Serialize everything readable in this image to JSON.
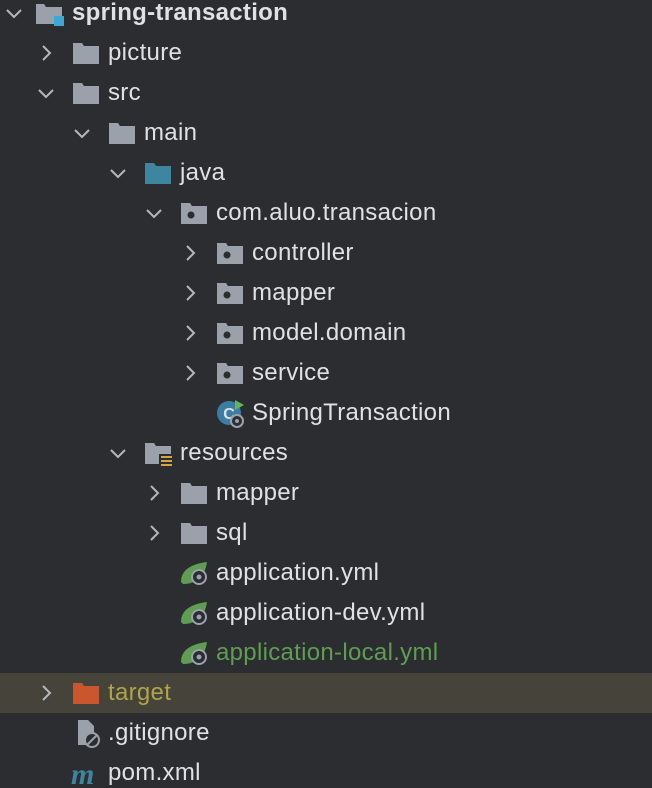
{
  "tree": {
    "root": {
      "label": "spring-transaction",
      "icon": "module-folder-icon"
    },
    "picture": {
      "label": "picture",
      "icon": "folder-icon"
    },
    "src": {
      "label": "src",
      "icon": "folder-icon"
    },
    "main": {
      "label": "main",
      "icon": "folder-icon"
    },
    "java": {
      "label": "java",
      "icon": "source-root-folder-icon"
    },
    "package": {
      "label": "com.aluo.transacion",
      "icon": "package-icon"
    },
    "controller": {
      "label": "controller",
      "icon": "package-icon"
    },
    "mapper_pkg": {
      "label": "mapper",
      "icon": "package-icon"
    },
    "model_domain": {
      "label": "model.domain",
      "icon": "package-icon"
    },
    "service": {
      "label": "service",
      "icon": "package-icon"
    },
    "spring_class": {
      "label": "SpringTransaction",
      "icon": "spring-boot-class-icon"
    },
    "resources": {
      "label": "resources",
      "icon": "resources-root-folder-icon"
    },
    "mapper_res": {
      "label": "mapper",
      "icon": "folder-icon"
    },
    "sql": {
      "label": "sql",
      "icon": "folder-icon"
    },
    "app_yml": {
      "label": "application.yml",
      "icon": "spring-config-icon"
    },
    "app_dev_yml": {
      "label": "application-dev.yml",
      "icon": "spring-config-icon"
    },
    "app_local_yml": {
      "label": "application-local.yml",
      "icon": "spring-config-icon",
      "status": "added"
    },
    "target": {
      "label": "target",
      "icon": "excluded-folder-icon",
      "status": "ignored"
    },
    "gitignore": {
      "label": ".gitignore",
      "icon": "ignore-file-icon"
    },
    "pom": {
      "label": "pom.xml",
      "icon": "maven-icon"
    }
  },
  "colors": {
    "background": "#2b2d30",
    "text": "#dfe1e5",
    "folder": "#9aa1ab",
    "source_root": "#3e86a0",
    "excluded": "#c9562c",
    "added_text": "#5f9e52",
    "ignored_text": "#b0a44a",
    "selected_row": "#45433a"
  }
}
